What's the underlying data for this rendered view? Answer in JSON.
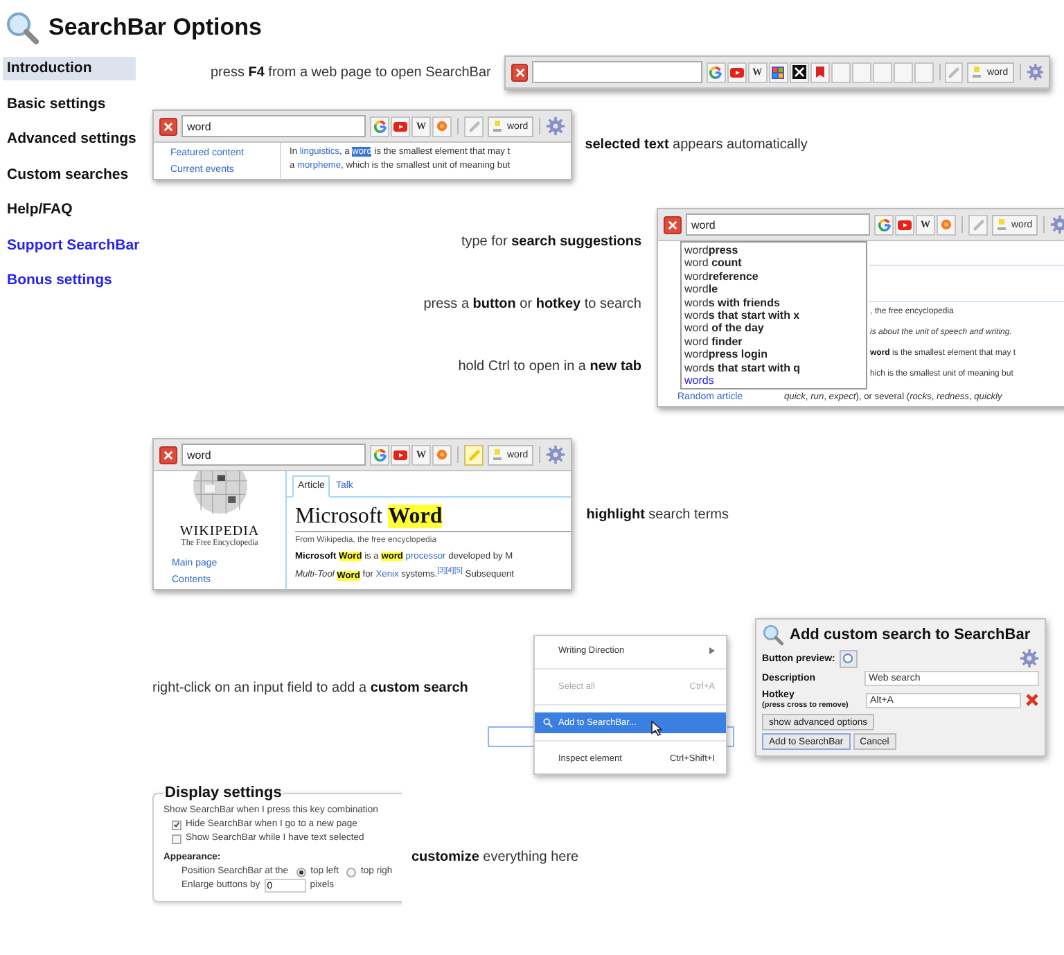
{
  "header": {
    "title": "SearchBar Options"
  },
  "nav": [
    {
      "label": "Introduction",
      "selected": true,
      "kind": "section"
    },
    {
      "label": "Basic settings",
      "selected": false,
      "kind": "section"
    },
    {
      "label": "Advanced settings",
      "selected": false,
      "kind": "section"
    },
    {
      "label": "Custom searches",
      "selected": false,
      "kind": "section"
    },
    {
      "label": "Help/FAQ",
      "selected": false,
      "kind": "section"
    },
    {
      "label": "Support SearchBar",
      "selected": false,
      "kind": "link"
    },
    {
      "label": "Bonus settings",
      "selected": false,
      "kind": "link"
    }
  ],
  "sections": [
    {
      "kind": "open",
      "captions": [
        "press **F4** from a web page to open SearchBar"
      ],
      "toolbar": {
        "engines": [
          {
            "kind": "google"
          },
          {
            "kind": "youtube"
          },
          {
            "kind": "wiki",
            "label": "W"
          },
          {
            "kind": "tiles"
          },
          {
            "kind": "x"
          },
          {
            "kind": "red"
          },
          {
            "kind": "empty"
          },
          {
            "kind": "empty"
          },
          {
            "kind": "empty"
          },
          {
            "kind": "empty"
          },
          {
            "kind": "empty"
          }
        ],
        "highlight_on": false,
        "highlight_label": "word"
      }
    },
    {
      "kind": "selection",
      "captions": [
        "**selected text** appears automatically"
      ],
      "toolbar": {
        "query": "word",
        "engines": [
          {
            "kind": "google"
          },
          {
            "kind": "youtube"
          },
          {
            "kind": "wiki",
            "label": "W"
          },
          {
            "kind": "orange"
          }
        ],
        "highlight_on": false,
        "highlight_label": "word"
      },
      "links": [
        "Featured content",
        "Current events"
      ],
      "lines": [
        [
          {
            "kind": "plain",
            "text": "In "
          },
          {
            "kind": "link",
            "text": "linguistics"
          },
          {
            "kind": "plain",
            "text": ", a "
          },
          {
            "kind": "selected",
            "text": "word"
          },
          {
            "kind": "plain",
            "text": " is the smallest element that may t"
          }
        ],
        [
          {
            "kind": "plain",
            "text": "a "
          },
          {
            "kind": "link",
            "text": "morpheme"
          },
          {
            "kind": "plain",
            "text": ", which is the smallest unit of meaning but"
          }
        ]
      ]
    },
    {
      "kind": "suggest",
      "captions": [
        "type for **search suggestions**",
        "press a **button** or **hotkey** to search",
        "hold Ctrl to open in a **new tab**"
      ],
      "toolbar": {
        "query": "word",
        "engines": [
          {
            "kind": "google"
          },
          {
            "kind": "youtube"
          },
          {
            "kind": "wiki",
            "label": "W"
          },
          {
            "kind": "orange"
          }
        ],
        "highlight_on": false,
        "highlight_label": "word"
      },
      "suggestions": [
        {
          "text": "word**press**",
          "kind": "suggestion"
        },
        {
          "text": "word **count**",
          "kind": "suggestion"
        },
        {
          "text": "word**reference**",
          "kind": "suggestion"
        },
        {
          "text": "word**le**",
          "kind": "suggestion"
        },
        {
          "text": "word**s with friends**",
          "kind": "suggestion"
        },
        {
          "text": "word**s that start with x**",
          "kind": "suggestion"
        },
        {
          "text": "word **of the day**",
          "kind": "suggestion"
        },
        {
          "text": "word **finder**",
          "kind": "suggestion"
        },
        {
          "text": "word**press login**",
          "kind": "suggestion"
        },
        {
          "text": "word**s that start with q**",
          "kind": "suggestion"
        },
        {
          "text": "words",
          "kind": "history"
        }
      ],
      "lines": [
        [
          {
            "kind": "plain",
            "text": ", the free encyclopedia"
          }
        ],
        [
          {
            "kind": "italic",
            "text": "is about the unit of speech and writing."
          }
        ],
        [
          {
            "kind": "bold",
            "text": "word"
          },
          {
            "kind": "plain",
            "text": " is the smallest element that may t"
          }
        ],
        [
          {
            "kind": "plain",
            "text": "hich is the smallest unit of meaning but"
          }
        ]
      ],
      "links": [
        "Random article"
      ],
      "bottom_line": [
        {
          "kind": "italic",
          "text": "quick"
        },
        {
          "kind": "plain",
          "text": ", "
        },
        {
          "kind": "italic",
          "text": "run"
        },
        {
          "kind": "plain",
          "text": ", "
        },
        {
          "kind": "italic",
          "text": "expect"
        },
        {
          "kind": "plain",
          "text": "), or several ("
        },
        {
          "kind": "italic",
          "text": "rocks"
        },
        {
          "kind": "plain",
          "text": ", "
        },
        {
          "kind": "italic",
          "text": "redness"
        },
        {
          "kind": "plain",
          "text": ", "
        },
        {
          "kind": "italic",
          "text": "quickly"
        }
      ]
    },
    {
      "kind": "highlight",
      "captions": [
        "**highlight** search terms"
      ],
      "toolbar": {
        "query": "word",
        "engines": [
          {
            "kind": "google"
          },
          {
            "kind": "youtube"
          },
          {
            "kind": "wiki",
            "label": "W"
          },
          {
            "kind": "orange"
          }
        ],
        "highlight_on": true,
        "highlight_label": "word"
      },
      "logo": {
        "name": "WIKIPEDIA",
        "tagline": "The Free Encyclopedia"
      },
      "links": [
        "Main page",
        "Contents"
      ],
      "tabs": [
        {
          "label": "Article",
          "selected": true
        },
        {
          "label": "Talk",
          "selected": false
        }
      ],
      "heading": [
        {
          "kind": "plain",
          "text": "Microsoft "
        },
        {
          "kind": "highlight",
          "text": "Word"
        }
      ],
      "subtitle": "From Wikipedia, the free encyclopedia",
      "lines": [
        [
          {
            "kind": "bold",
            "text": "Microsoft "
          },
          {
            "kind": "bold-highlight",
            "text": "Word"
          },
          {
            "kind": "plain",
            "text": " is a "
          },
          {
            "kind": "bold-highlight",
            "text": "word"
          },
          {
            "kind": "link",
            "text": " processor"
          },
          {
            "kind": "plain",
            "text": " developed by M"
          }
        ],
        [
          {
            "kind": "italic",
            "text": "Multi-Tool "
          },
          {
            "kind": "bold-highlight",
            "text": "Word"
          },
          {
            "kind": "plain",
            "text": " for "
          },
          {
            "kind": "link",
            "text": "Xenix"
          },
          {
            "kind": "plain",
            "text": " systems."
          },
          {
            "kind": "ref",
            "text": "[3][4][5]"
          },
          {
            "kind": "plain",
            "text": " Subsequent"
          }
        ]
      ]
    },
    {
      "kind": "custom",
      "captions": [
        "right-click on an input field to add a **custom search**"
      ],
      "menu": [
        {
          "label": "Writing Direction",
          "kind": "submenu",
          "selected": false,
          "disabled": false
        },
        {
          "label": "Select all",
          "shortcut": "Ctrl+A",
          "kind": "plain",
          "selected": false,
          "disabled": true
        },
        {
          "label": "Add to SearchBar...",
          "kind": "search",
          "selected": true,
          "disabled": false
        },
        {
          "label": "Inspect element",
          "shortcut": "Ctrl+Shift+I",
          "kind": "plain",
          "selected": false,
          "disabled": false
        }
      ],
      "dialog": {
        "title": "Add custom search to SearchBar",
        "preview_label": "Button preview:",
        "fields": [
          {
            "label": "Description",
            "value": "Web search",
            "kind": "text"
          },
          {
            "label": "Hotkey",
            "note": "(press cross to remove)",
            "value": "Alt+A",
            "kind": "hotkey"
          }
        ],
        "advanced": "show advanced options",
        "actions": [
          "Add to SearchBar",
          "Cancel"
        ]
      }
    },
    {
      "kind": "settings",
      "captions": [
        "**customize** everything here"
      ],
      "settings": {
        "legend": "Display settings",
        "intro": "Show SearchBar when I press this key combination",
        "checks": [
          {
            "label": "Hide SearchBar when I go to a new page",
            "checked": true
          },
          {
            "label": "Show SearchBar while I have text selected",
            "checked": false
          }
        ],
        "group": "Appearance:",
        "position_label": "Position SearchBar at the",
        "positions": [
          {
            "label": "top left",
            "selected": true
          },
          {
            "label": "top righ",
            "selected": false
          }
        ],
        "enlarge_label": "Enlarge buttons by",
        "enlarge_value": "0",
        "enlarge_unit": "pixels"
      }
    }
  ]
}
